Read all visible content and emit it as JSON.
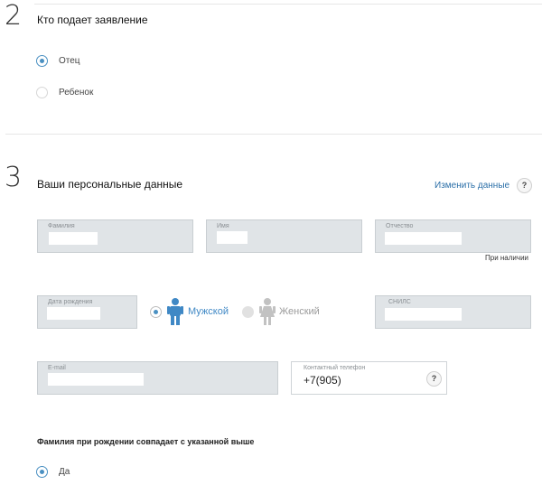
{
  "section2": {
    "number": "2",
    "title": "Кто подает заявление",
    "options": [
      {
        "label": "Отец",
        "checked": true
      },
      {
        "label": "Ребенок",
        "checked": false
      }
    ]
  },
  "section3": {
    "number": "3",
    "title": "Ваши персональные данные",
    "change_link": "Изменить данные",
    "help": "?",
    "fields": {
      "surname": {
        "label": "Фамилия",
        "value": ""
      },
      "name": {
        "label": "Имя",
        "value": ""
      },
      "patronymic": {
        "label": "Отчество",
        "value": ""
      },
      "patronymic_note": "При наличии",
      "birthdate": {
        "label": "Дата рождения",
        "value": ""
      },
      "snils": {
        "label": "СНИЛС",
        "value": ""
      },
      "email": {
        "label": "E-mail",
        "value": ""
      },
      "phone": {
        "label": "Контактный телефон",
        "value": "+7(905)",
        "help": "?"
      }
    },
    "gender": {
      "male": {
        "label": "Мужской",
        "checked": true,
        "color": "#3f88c5"
      },
      "female": {
        "label": "Женский",
        "checked": false,
        "color": "#b9b9b9"
      }
    },
    "maiden_name": {
      "title": "Фамилия при рождении совпадает с указанной выше",
      "option": {
        "label": "Да",
        "checked": true
      }
    }
  },
  "colors": {
    "accent": "#4a90c2",
    "link": "#2b6fa8",
    "field_bg": "#e0e4e7"
  }
}
